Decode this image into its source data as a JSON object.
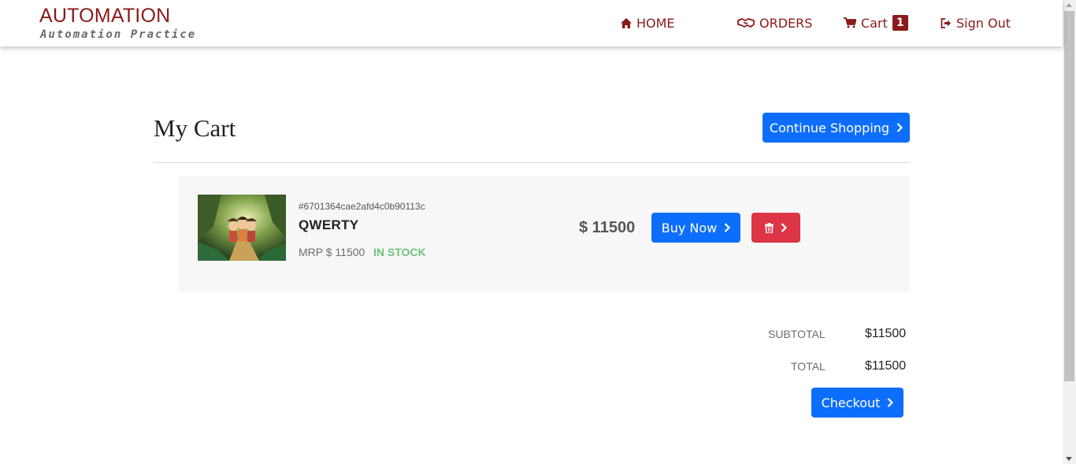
{
  "header": {
    "brand_title": "AUTOMATION",
    "brand_subtitle": "Automation Practice",
    "nav": {
      "home": "HOME",
      "orders": "ORDERS",
      "cart": "Cart",
      "cart_count": "1",
      "sign_out": "Sign Out"
    }
  },
  "page": {
    "title": "My Cart",
    "continue_label": "Continue Shopping"
  },
  "cart_items": [
    {
      "id": "#6701364cae2afd4c0b90113c",
      "name": "QWERTY",
      "mrp": "MRP $ 11500",
      "stock": "IN STOCK",
      "price": "$ 11500",
      "buy_label": "Buy Now"
    }
  ],
  "summary": {
    "subtotal_label": "SUBTOTAL",
    "subtotal_value": "$11500",
    "total_label": "TOTAL",
    "total_value": "$11500",
    "checkout_label": "Checkout"
  },
  "colors": {
    "brand": "#8b1a1a",
    "primary": "#0d6efd",
    "danger": "#dc3545",
    "in_stock": "#6fc37b"
  },
  "icons": {
    "home": "home-icon",
    "orders": "handshake-icon",
    "cart": "shopping-cart-icon",
    "sign_out": "sign-out-icon",
    "chevron": "chevron-right-icon",
    "delete": "trash-icon"
  }
}
